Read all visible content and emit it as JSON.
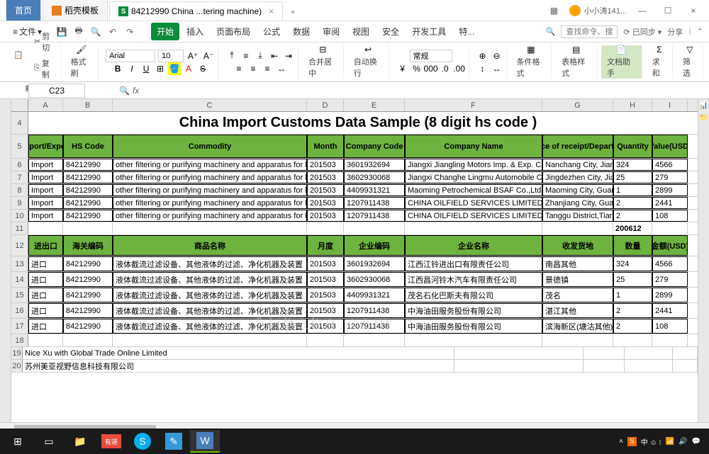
{
  "tabs": {
    "home": "首页",
    "template": "稻壳模板",
    "doc": "84212990 China ...tering machine)"
  },
  "user": "小小涛141...",
  "filemenu": "文件",
  "ribbons": [
    "开始",
    "插入",
    "页面布局",
    "公式",
    "数据",
    "审阅",
    "视图",
    "安全",
    "开发工具",
    "特..."
  ],
  "search_label": "查找命令、搜索模板",
  "sync": "已同步",
  "share": "分享",
  "toolbar": {
    "cut": "剪切",
    "paste": "粘贴",
    "copy": "复制",
    "painter": "格式刷",
    "font": "Arial",
    "size": "10",
    "merge": "合并居中",
    "wrap": "自动换行",
    "format": "常规",
    "cond": "条件格式",
    "style": "表格样式",
    "doc": "文档助手",
    "sum": "求和",
    "filter": "筛选"
  },
  "namebox": "C23",
  "cols": [
    "A",
    "B",
    "C",
    "D",
    "E",
    "F",
    "G",
    "H",
    "I"
  ],
  "title": "China Import Customs Data Sample (8 digit hs code )",
  "hdr_en": [
    "Import/Export",
    "HS Code",
    "Commodity",
    "Month",
    "Company Code",
    "Company Name",
    "place of receipt/Departure",
    "Quantity",
    "Value(USD)"
  ],
  "rows_en": [
    [
      "Import",
      "84212990",
      "other filtering or purifying machinery and apparatus for liq",
      "201503",
      "3601932694",
      "Jiangxi Jiangling Motors Imp. & Exp. C",
      "Nanchang City, Jiang",
      "324",
      "4566"
    ],
    [
      "Import",
      "84212990",
      "other filtering or purifying machinery and apparatus for liq",
      "201503",
      "3602930068",
      "Jiangxi Changhe Lingmu Automobile C",
      "Jingdezhen City, Jian",
      "25",
      "279"
    ],
    [
      "Import",
      "84212990",
      "other filtering or purifying machinery and apparatus for liq",
      "201503",
      "4409931321",
      "Maoming Petrochemical BSAF Co.,Ltd",
      "Maoming City, Guang",
      "1",
      "2899"
    ],
    [
      "Import",
      "84212990",
      "other filtering or purifying machinery and apparatus for liq",
      "201503",
      "1207911438",
      "CHINA OILFIELD SERVICES LIMITED",
      "Zhanjiang City, Guan",
      "2",
      "2441"
    ],
    [
      "Import",
      "84212990",
      "other filtering or purifying machinery and apparatus for liq",
      "201503",
      "1207911438",
      "CHINA OILFIELD SERVICES LIMITED",
      "Tanggu District,Tianji",
      "2",
      "108"
    ]
  ],
  "extra_row11": "200612",
  "hdr_cn": [
    "进出口",
    "海关编码",
    "商品名称",
    "月度",
    "企业编码",
    "企业名称",
    "收发货地",
    "数量",
    "金额(USD)"
  ],
  "rows_cn": [
    [
      "进口",
      "84212990",
      "液体截流过滤设备、其他液体的过滤、净化机器及装置",
      "201503",
      "3601932694",
      "江西江铃进出口有限责任公司",
      "南昌其他",
      "324",
      "4566"
    ],
    [
      "进口",
      "84212990",
      "液体截流过滤设备、其他液体的过滤、净化机器及装置",
      "201503",
      "3602930068",
      "江西昌河铃木汽车有限责任公司",
      "景德镇",
      "25",
      "279"
    ],
    [
      "进口",
      "84212990",
      "液体截流过滤设备、其他液体的过滤、净化机器及装置",
      "201503",
      "4409931321",
      "茂名石化巴斯夫有限公司",
      "茂名",
      "1",
      "2899"
    ],
    [
      "进口",
      "84212990",
      "液体截流过滤设备、其他液体的过滤、净化机器及装置",
      "201503",
      "1207911438",
      "中海油田服务股份有限公司",
      "湛江其他",
      "2",
      "2441"
    ],
    [
      "进口",
      "84212990",
      "液体截流过滤设备、其他液体的过滤、净化机器及装置",
      "201503",
      "1207911438",
      "中海油田服务股份有限公司",
      "滨海新区(塘沽其他)",
      "2",
      "108"
    ]
  ],
  "footer1": "Nice Xu with Global Trade Online Limited",
  "footer2": "苏州美亚视野信息科技有限公司",
  "watermark": "Alibaba.com"
}
